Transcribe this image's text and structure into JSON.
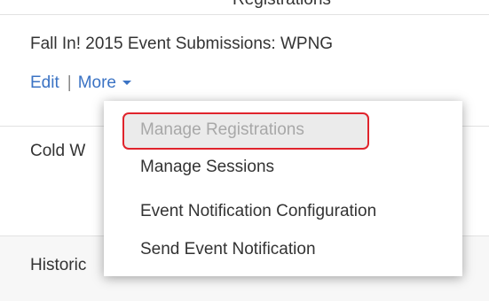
{
  "header_cutoff_text": "Registrations",
  "events": [
    {
      "title": "Fall In! 2015 Event Submissions: WPNG",
      "edit_label": "Edit",
      "separator": "|",
      "more_label": "More"
    },
    {
      "title": "Cold W"
    },
    {
      "title": "Historic"
    }
  ],
  "more_menu": {
    "items": [
      {
        "label": "Manage Registrations",
        "state": "disabled"
      },
      {
        "label": "Manage Sessions"
      },
      {
        "label": "Event Notification Configuration"
      },
      {
        "label": "Send Event Notification"
      }
    ]
  },
  "colors": {
    "link": "#3b73c4",
    "highlight_border": "#e0242c",
    "disabled_text": "#a8a8a8",
    "text": "#333333"
  },
  "icons": {
    "more_dropdown": "caret-down-icon"
  }
}
